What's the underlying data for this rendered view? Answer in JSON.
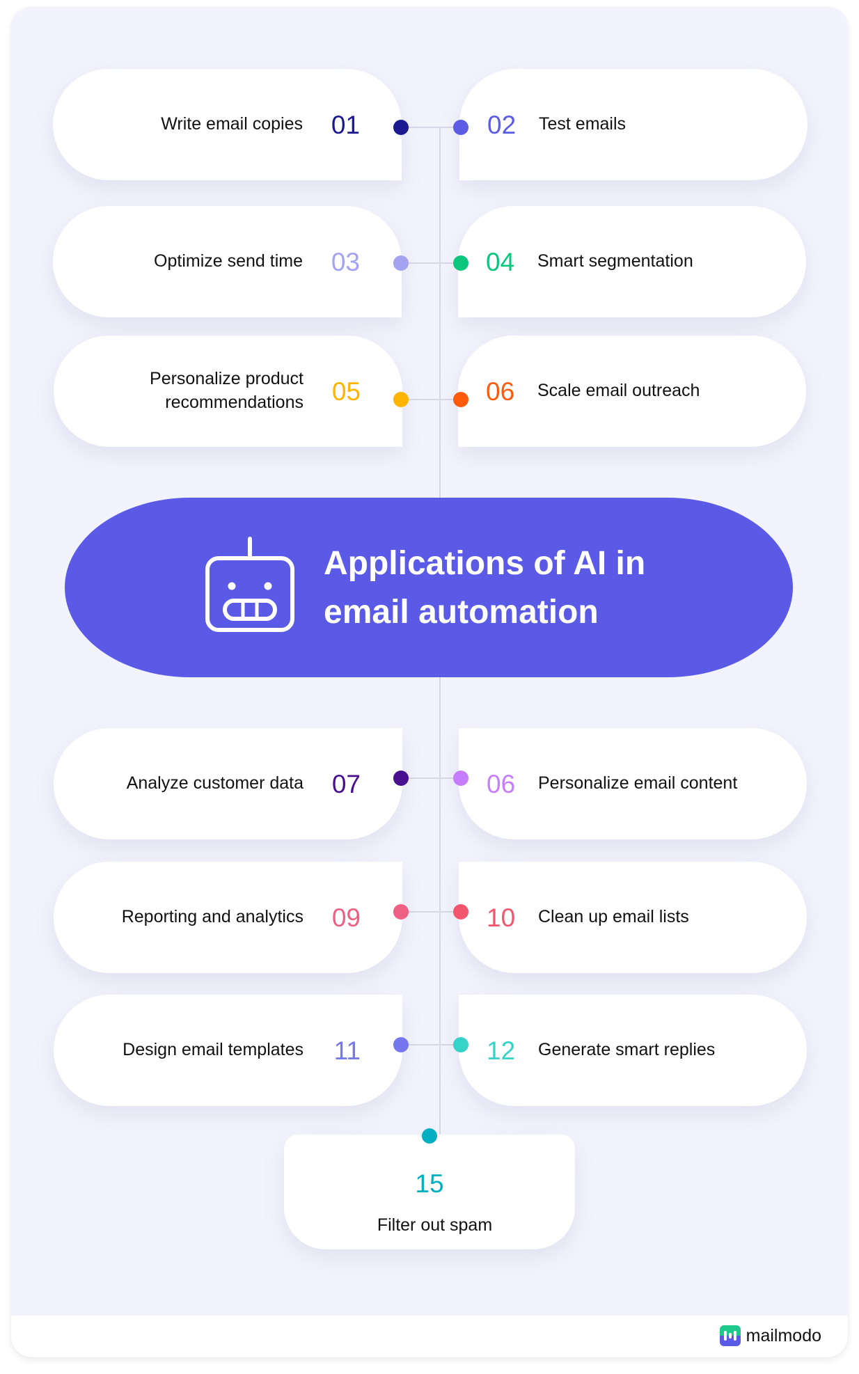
{
  "title": {
    "line1": "Applications of AI in",
    "line2": "email automation",
    "icon": "robot-icon"
  },
  "items_top": [
    {
      "left": {
        "num": "01",
        "label": "Write email copies",
        "color": "#1b1890"
      },
      "right": {
        "num": "02",
        "label": "Test emails",
        "color": "#5b5be6"
      }
    },
    {
      "left": {
        "num": "03",
        "label": "Optimize send time",
        "color": "#a3a3f2"
      },
      "right": {
        "num": "04",
        "label": "Smart segmentation",
        "color": "#0bc67c"
      }
    },
    {
      "left": {
        "num": "05",
        "label_line1": "Personalize product",
        "label_line2": "recommendations",
        "color": "#ffb400"
      },
      "right": {
        "num": "06",
        "label": "Scale email outreach",
        "color": "#ff5a0a"
      }
    }
  ],
  "items_bottom": [
    {
      "left": {
        "num": "07",
        "label": "Analyze customer data",
        "color": "#4a0f8f"
      },
      "right": {
        "num": "06",
        "label": "Personalize email content",
        "color": "#c77dff"
      }
    },
    {
      "left": {
        "num": "09",
        "label": "Reporting and analytics",
        "color": "#ef5e83"
      },
      "right": {
        "num": "10",
        "label": "Clean up email lists",
        "color": "#f4556e"
      }
    },
    {
      "left": {
        "num": "11",
        "label": "Design email templates",
        "color": "#7477ee"
      },
      "right": {
        "num": "12",
        "label": "Generate smart replies",
        "color": "#35d3c8"
      }
    }
  ],
  "item_final": {
    "num": "15",
    "label": "Filter out spam",
    "color": "#00afc0"
  },
  "footer": {
    "brand": "mailmodo",
    "icon": "mailmodo-logo-icon"
  },
  "colors": {
    "accent": "#5a5ae6",
    "background": "#f2f3fc",
    "connector": "#d7d7e8"
  }
}
